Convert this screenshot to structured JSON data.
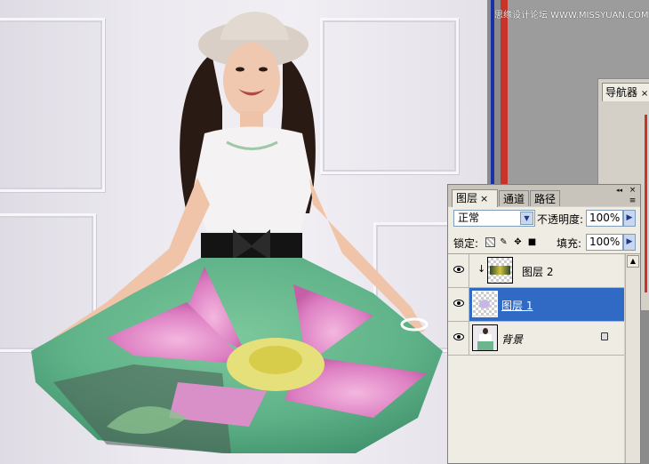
{
  "watermark": "思缘设计论坛 WWW.MISSYUAN.COM",
  "navigator": {
    "tab_label": "导航器",
    "close_label": "×"
  },
  "layers_panel": {
    "tabs": [
      {
        "label": "图层",
        "close": "×"
      },
      {
        "label": "通道"
      },
      {
        "label": "路径"
      }
    ],
    "window_buttons": {
      "collapse": "◂◂",
      "close": "×",
      "menu": "≡"
    },
    "blend_mode": "正常",
    "opacity_label": "不透明度:",
    "opacity_value": "100%",
    "lock_label": "锁定:",
    "fill_label": "填充:",
    "fill_value": "100%",
    "layers": [
      {
        "name": "图层 2",
        "clipped": true,
        "selected": false,
        "visible": true
      },
      {
        "name": "图层 1",
        "clipped": false,
        "selected": true,
        "visible": true
      },
      {
        "name": "背景",
        "clipped": false,
        "selected": false,
        "visible": true,
        "locked": true
      }
    ]
  },
  "colors": {
    "selection": "#316ac5",
    "panel": "#d4d0c8",
    "workspace": "#8b8b8b"
  }
}
